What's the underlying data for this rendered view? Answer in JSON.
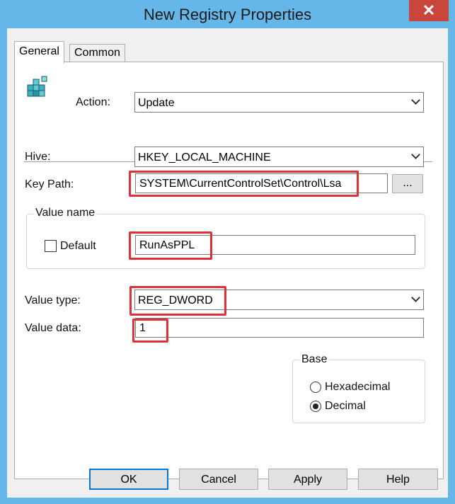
{
  "window": {
    "title": "New Registry Properties",
    "close_label": "✕"
  },
  "tabs": [
    {
      "label": "General",
      "active": true
    },
    {
      "label": "Common",
      "active": false
    }
  ],
  "icon": "registry-icon",
  "action": {
    "label": "Action:",
    "value": "Update"
  },
  "hive": {
    "label": "Hive:",
    "value": "HKEY_LOCAL_MACHINE"
  },
  "key_path": {
    "label": "Key Path:",
    "value": "SYSTEM\\CurrentControlSet\\Control\\Lsa",
    "browse_label": "..."
  },
  "value_name": {
    "group_label": "Value name",
    "default_label": "Default",
    "default_checked": false,
    "value": "RunAsPPL"
  },
  "value_type": {
    "label": "Value type:",
    "value": "REG_DWORD"
  },
  "value_data": {
    "label": "Value data:",
    "value": "1"
  },
  "base": {
    "group_label": "Base",
    "options": [
      {
        "label": "Hexadecimal",
        "selected": false
      },
      {
        "label": "Decimal",
        "selected": true
      }
    ]
  },
  "buttons": {
    "ok": "OK",
    "cancel": "Cancel",
    "apply": "Apply",
    "help": "Help"
  },
  "colors": {
    "title_bar": "#65b7ea",
    "close_button": "#c9463d",
    "highlight": "#e0303a",
    "dialog_bg": "#f0f0f0"
  }
}
